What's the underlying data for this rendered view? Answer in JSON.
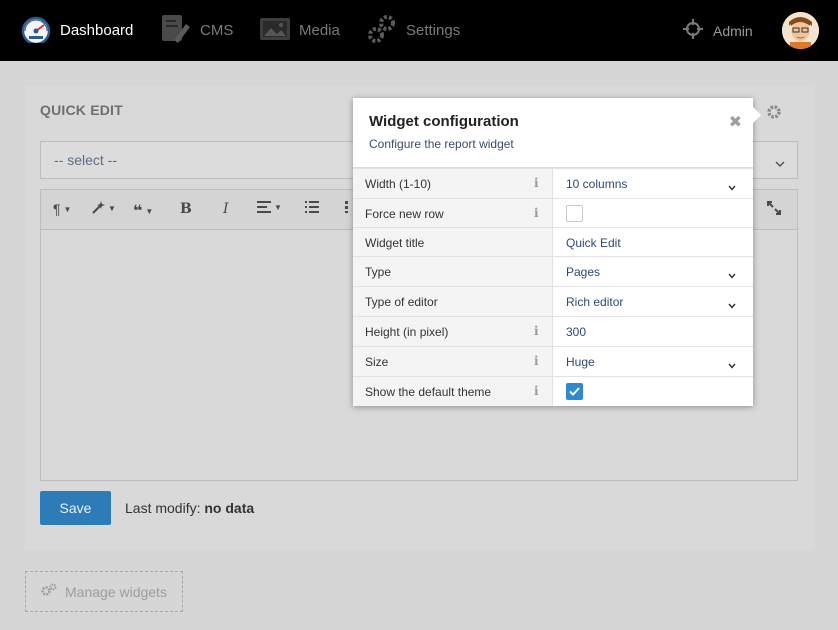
{
  "nav": {
    "dashboard": "Dashboard",
    "cms": "CMS",
    "media": "Media",
    "settings": "Settings",
    "admin": "Admin"
  },
  "panel": {
    "title": "QUICK EDIT",
    "select_value": "-- select --",
    "save_label": "Save",
    "last_modify_label": "Last modify:",
    "last_modify_value": "no data"
  },
  "manage_widgets": "Manage widgets",
  "popover": {
    "title": "Widget configuration",
    "subtitle": "Configure the report widget",
    "rows": [
      {
        "label": "Width (1-10)",
        "value": "10 columns",
        "info": true,
        "type": "select"
      },
      {
        "label": "Force new row",
        "value": "",
        "info": true,
        "type": "checkbox",
        "checked": false
      },
      {
        "label": "Widget title",
        "value": "Quick Edit",
        "info": false,
        "type": "text"
      },
      {
        "label": "Type",
        "value": "Pages",
        "info": false,
        "type": "select"
      },
      {
        "label": "Type of editor",
        "value": "Rich editor",
        "info": false,
        "type": "select"
      },
      {
        "label": "Height (in pixel)",
        "value": "300",
        "info": true,
        "type": "text"
      },
      {
        "label": "Size",
        "value": "Huge",
        "info": true,
        "type": "select"
      },
      {
        "label": "Show the default theme",
        "value": "",
        "info": true,
        "type": "checkbox",
        "checked": true
      }
    ]
  },
  "colors": {
    "navbar": "#000000",
    "primary": "#2e7cb7",
    "checkbox_checked": "#2e8ad0",
    "link_text": "#2c4a74"
  }
}
